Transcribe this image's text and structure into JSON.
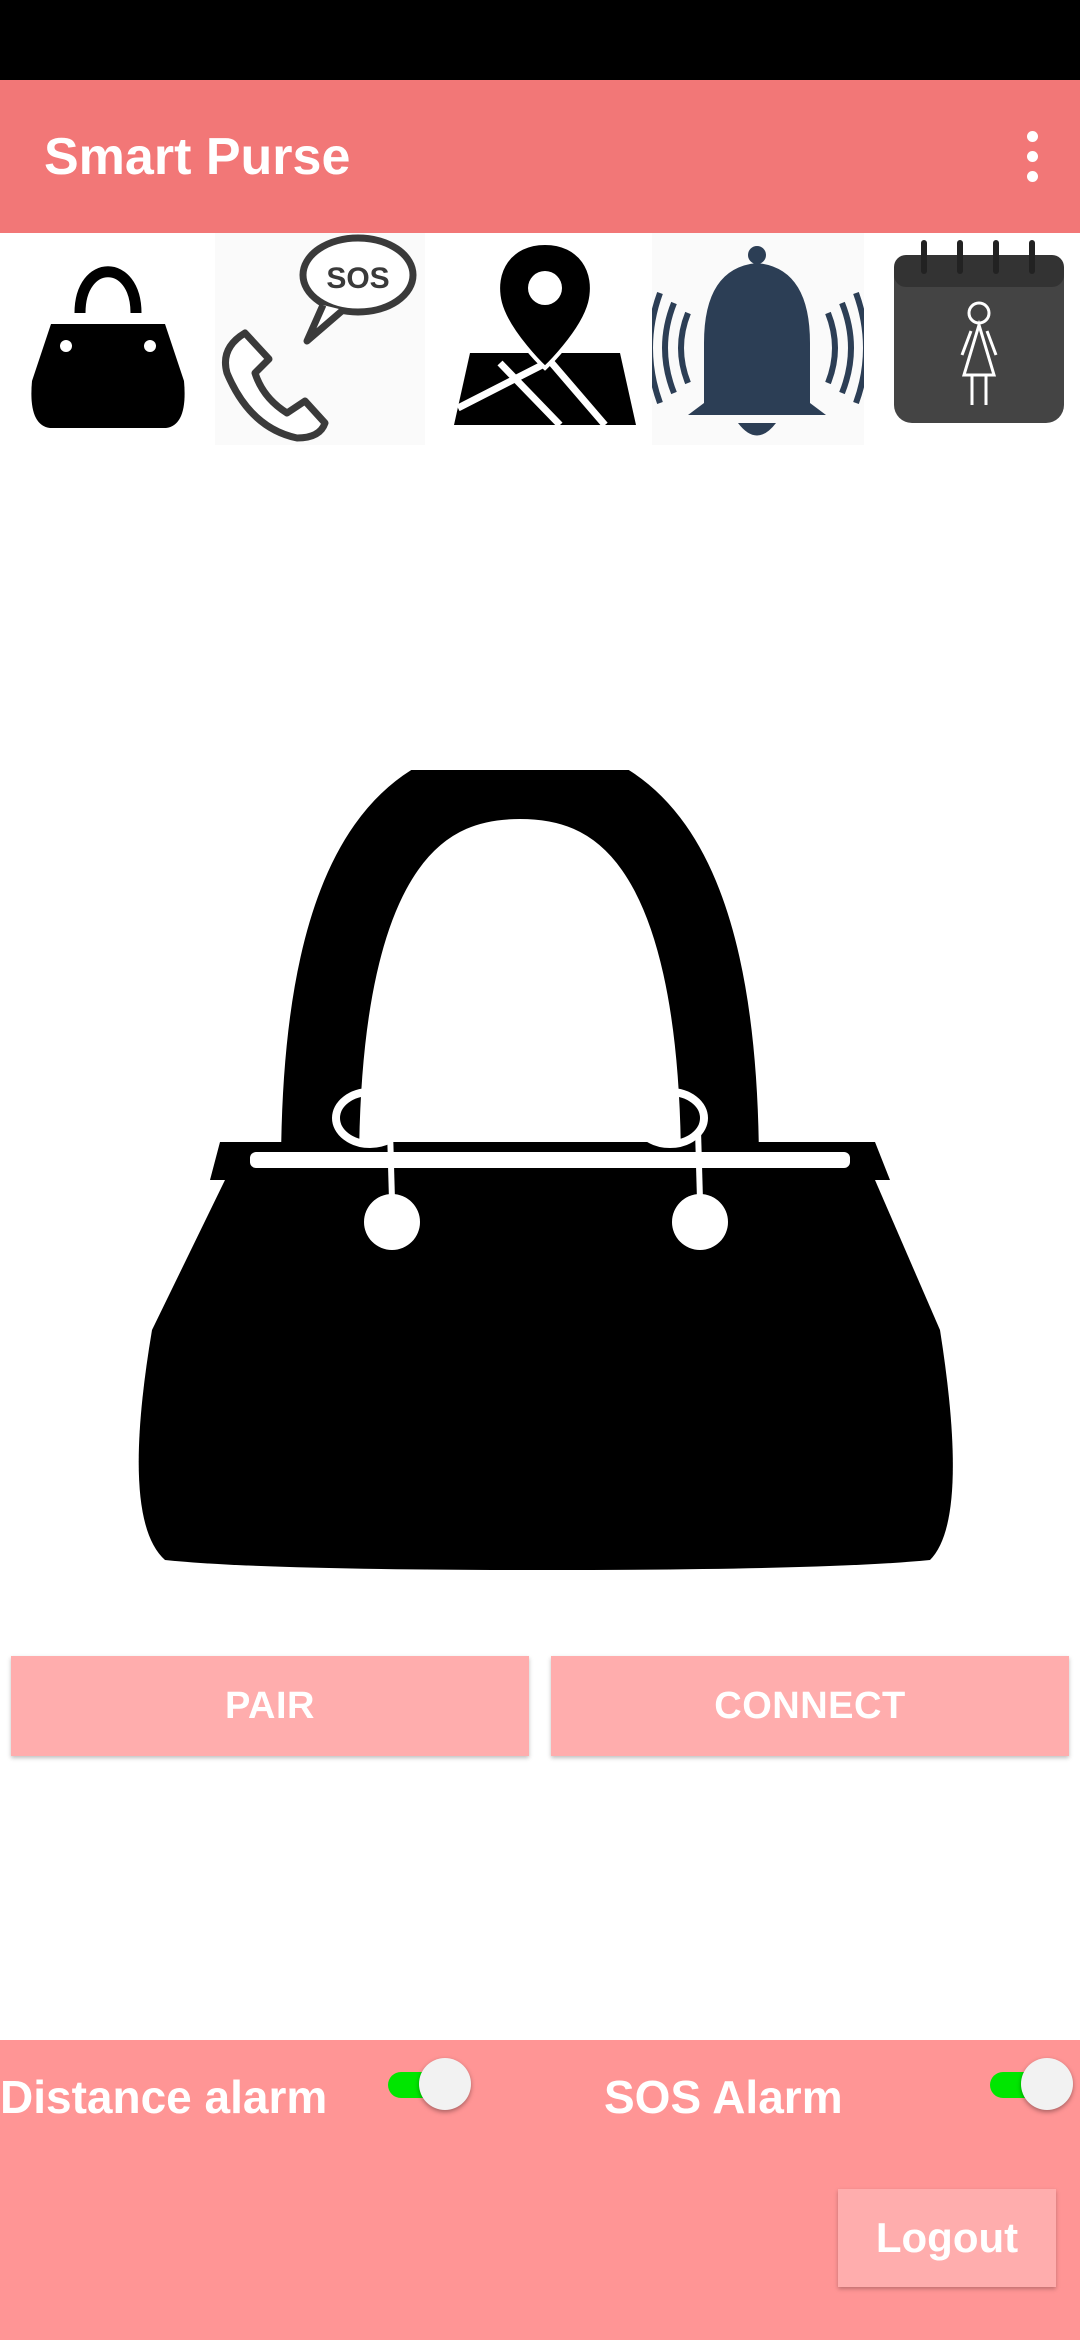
{
  "app": {
    "title": "Smart Purse"
  },
  "toolbar": {
    "menu_icon": "more-vert-icon"
  },
  "quick_icons": [
    {
      "name": "handbag-icon"
    },
    {
      "name": "sos-call-icon",
      "text": "SOS"
    },
    {
      "name": "map-location-icon"
    },
    {
      "name": "ringing-bell-icon"
    },
    {
      "name": "calendar-woman-icon"
    }
  ],
  "actions": {
    "pair_label": "PAIR",
    "connect_label": "CONNECT"
  },
  "toggles": {
    "distance": {
      "label": "Distance alarm",
      "on": true
    },
    "sos": {
      "label": "SOS Alarm",
      "on": true
    }
  },
  "logout": {
    "label": "Logout"
  },
  "colors": {
    "app_bar": "#f27777",
    "button": "#ffadad",
    "bottom_panel": "#ff9595",
    "switch_track": "#00e600"
  }
}
